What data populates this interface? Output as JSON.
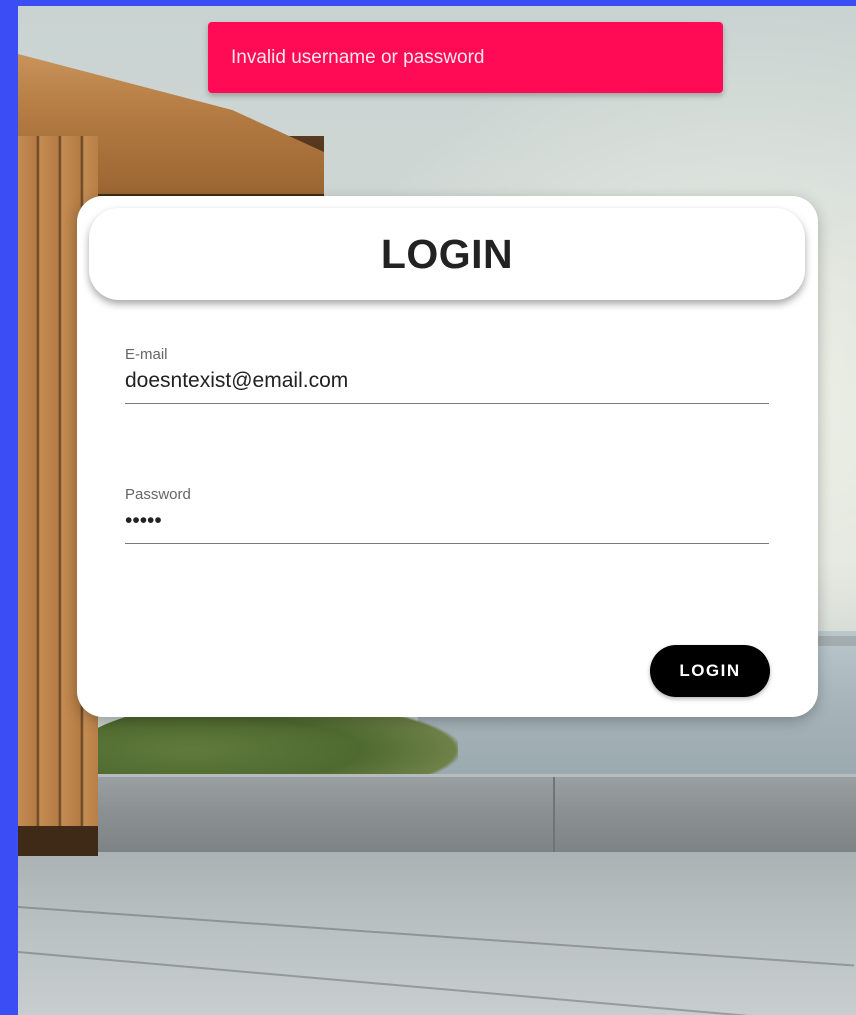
{
  "toast": {
    "message": "Invalid username or password",
    "color": "#ff0a54"
  },
  "login_card": {
    "title": "LOGIN",
    "email": {
      "label": "E-mail",
      "value": "doesntexist@email.com"
    },
    "password": {
      "label": "Password",
      "value": "•••••"
    },
    "submit_label": "LOGIN"
  },
  "colors": {
    "frame_border": "#3b4ef5",
    "button_bg": "#000000"
  }
}
